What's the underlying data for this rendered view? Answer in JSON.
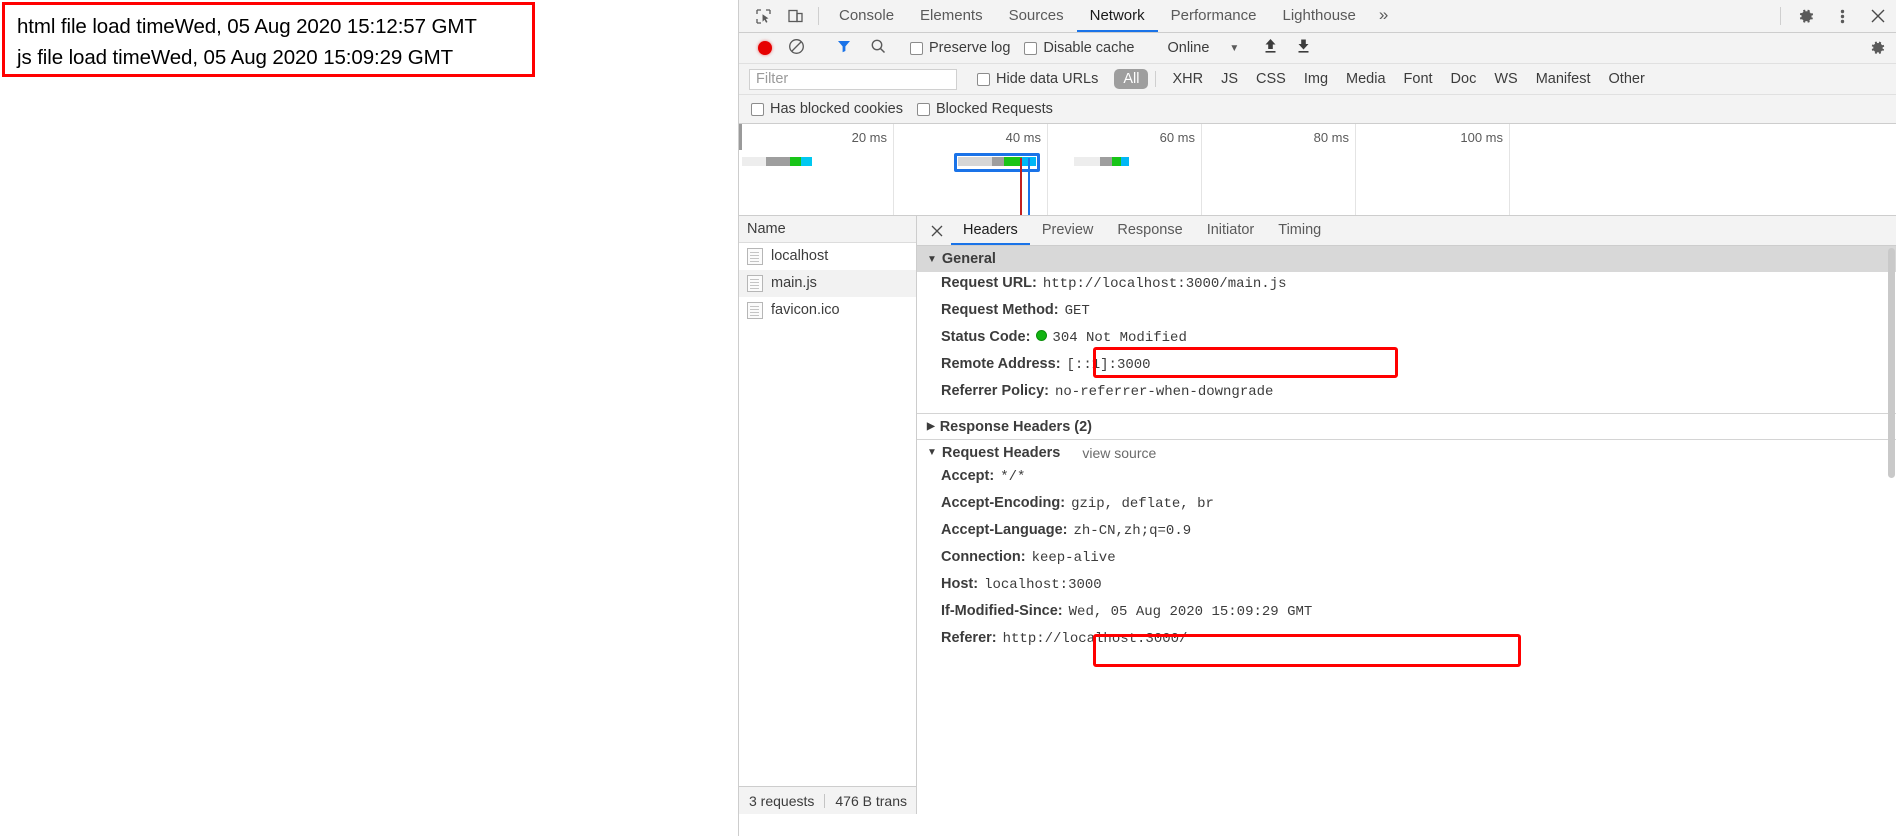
{
  "page": {
    "callout_lines": [
      "html file load timeWed, 05 Aug 2020 15:12:57 GMT",
      "js file load timeWed, 05 Aug 2020 15:09:29 GMT"
    ]
  },
  "devtools": {
    "main_tabs": [
      {
        "label": "Console",
        "selected": false
      },
      {
        "label": "Elements",
        "selected": false
      },
      {
        "label": "Sources",
        "selected": false
      },
      {
        "label": "Network",
        "selected": true
      },
      {
        "label": "Performance",
        "selected": false
      },
      {
        "label": "Lighthouse",
        "selected": false
      }
    ],
    "more_tabs_label": "»",
    "inspect_icon": "inspect-element-icon",
    "device_icon": "device-toolbar-icon",
    "settings_icon": "gear-icon",
    "menu_icon": "kebab-menu-icon",
    "close_icon": "close-icon",
    "controls": {
      "record_label": "record-button",
      "clear_label": "clear-button",
      "filter_toggle_label": "filter-toggle",
      "search_label": "search-button",
      "preserve_log": "Preserve log",
      "disable_cache": "Disable cache",
      "throttling": "Online",
      "throttling_caret": "▼",
      "import_label": "import-har-button",
      "export_label": "export-har-button",
      "settings_label": "network-settings-button"
    },
    "filter": {
      "placeholder": "Filter",
      "value": "",
      "hide_data_urls": "Hide data URLs",
      "types": [
        {
          "label": "All",
          "selected": true
        },
        {
          "label": "XHR",
          "selected": false
        },
        {
          "label": "JS",
          "selected": false
        },
        {
          "label": "CSS",
          "selected": false
        },
        {
          "label": "Img",
          "selected": false
        },
        {
          "label": "Media",
          "selected": false
        },
        {
          "label": "Font",
          "selected": false
        },
        {
          "label": "Doc",
          "selected": false
        },
        {
          "label": "WS",
          "selected": false
        },
        {
          "label": "Manifest",
          "selected": false
        },
        {
          "label": "Other",
          "selected": false
        }
      ],
      "has_blocked_cookies": "Has blocked cookies",
      "blocked_requests": "Blocked Requests"
    },
    "overview": {
      "ticks": [
        "20 ms",
        "40 ms",
        "60 ms",
        "80 ms",
        "100 ms"
      ]
    },
    "requests": {
      "column_header": "Name",
      "rows": [
        {
          "name": "localhost",
          "selected": false
        },
        {
          "name": "main.js",
          "selected": true
        },
        {
          "name": "favicon.ico",
          "selected": false
        }
      ],
      "summary_count": "3 requests",
      "summary_transferred": "476 B trans"
    },
    "detail": {
      "tabs": [
        {
          "label": "Headers",
          "selected": true
        },
        {
          "label": "Preview",
          "selected": false
        },
        {
          "label": "Response",
          "selected": false
        },
        {
          "label": "Initiator",
          "selected": false
        },
        {
          "label": "Timing",
          "selected": false
        }
      ],
      "general": {
        "title": "General",
        "rows": [
          {
            "key": "Request URL:",
            "value": "http://localhost:3000/main.js",
            "highlight": false
          },
          {
            "key": "Request Method:",
            "value": "GET",
            "highlight": false
          },
          {
            "key": "Status Code:",
            "value": "304 Not Modified",
            "status_dot": "#12b312",
            "highlight": true
          },
          {
            "key": "Remote Address:",
            "value": "[::1]:3000",
            "highlight": false
          },
          {
            "key": "Referrer Policy:",
            "value": "no-referrer-when-downgrade",
            "highlight": false
          }
        ]
      },
      "response_headers": {
        "title": "Response Headers (2)",
        "collapsed": true
      },
      "request_headers": {
        "title": "Request Headers",
        "view_source": "view source",
        "rows": [
          {
            "key": "Accept:",
            "value": "*/*",
            "highlight": false
          },
          {
            "key": "Accept-Encoding:",
            "value": "gzip, deflate, br",
            "highlight": false
          },
          {
            "key": "Accept-Language:",
            "value": "zh-CN,zh;q=0.9",
            "highlight": false
          },
          {
            "key": "Connection:",
            "value": "keep-alive",
            "highlight": false
          },
          {
            "key": "Host:",
            "value": "localhost:3000",
            "highlight": false
          },
          {
            "key": "If-Modified-Since:",
            "value": "Wed, 05 Aug 2020 15:09:29 GMT",
            "highlight": true
          },
          {
            "key": "Referer:",
            "value": "http://localhost:3000/",
            "highlight": false
          }
        ]
      }
    },
    "colors": {
      "accent": "#1a73e8",
      "record": "#e60000",
      "highlight": "#ff0000",
      "status_ok": "#12b312"
    }
  }
}
